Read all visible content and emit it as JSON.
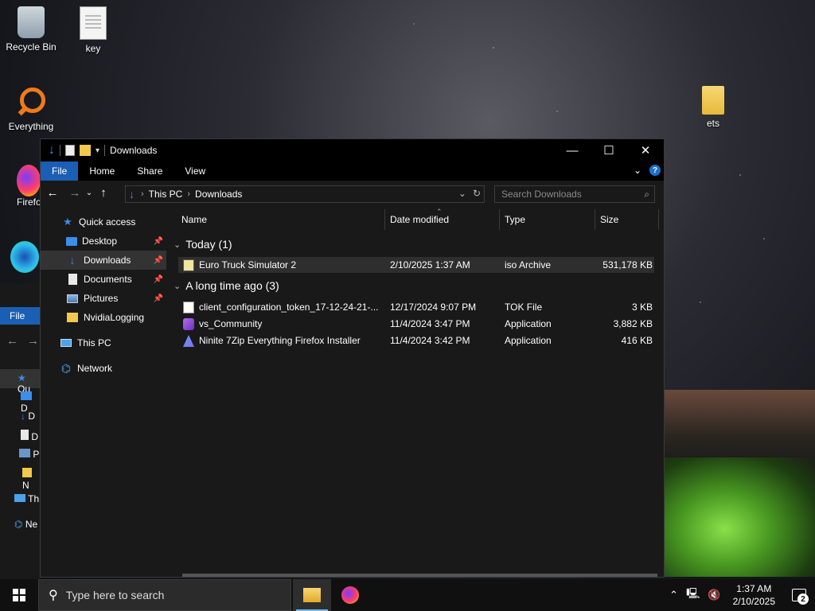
{
  "desktop": {
    "icons": [
      {
        "label": "Recycle Bin"
      },
      {
        "label": "key"
      },
      {
        "label": "Everything"
      },
      {
        "label": "Firefo"
      },
      {
        "label": "ets"
      }
    ]
  },
  "background_window": {
    "file_tab": "File",
    "nav_labels": [
      "Qu",
      "D",
      "D",
      "D",
      "P",
      "N",
      "Th",
      "Ne"
    ]
  },
  "window": {
    "title": "Downloads",
    "controls": {
      "minimize": "—",
      "maximize": "☐",
      "close": "✕"
    },
    "ribbon_tabs": [
      "File",
      "Home",
      "Share",
      "View"
    ],
    "address": {
      "crumbs": [
        "This PC",
        "Downloads"
      ]
    },
    "search": {
      "placeholder": "Search Downloads"
    },
    "nav_pane": [
      {
        "label": "Quick access",
        "icon": "star-icon"
      },
      {
        "label": "Desktop",
        "icon": "desktop-icon",
        "pinned": true
      },
      {
        "label": "Downloads",
        "icon": "download-icon",
        "pinned": true,
        "selected": true
      },
      {
        "label": "Documents",
        "icon": "document-icon",
        "pinned": true
      },
      {
        "label": "Pictures",
        "icon": "pictures-icon",
        "pinned": true
      },
      {
        "label": "NvidiaLogging",
        "icon": "folder-icon"
      },
      {
        "label": "This PC",
        "icon": "computer-icon"
      },
      {
        "label": "Network",
        "icon": "network-icon"
      }
    ],
    "columns": [
      "Name",
      "Date modified",
      "Type",
      "Size"
    ],
    "groups": [
      {
        "label": "Today (1)",
        "files": [
          {
            "name": "Euro Truck Simulator 2",
            "date": "2/10/2025 1:37 AM",
            "type": "iso Archive",
            "size": "531,178 KB",
            "icon": "iso-file-icon",
            "selected": true
          }
        ]
      },
      {
        "label": "A long time ago (3)",
        "files": [
          {
            "name": "client_configuration_token_17-12-24-21-...",
            "date": "12/17/2024 9:07 PM",
            "type": "TOK File",
            "size": "3 KB",
            "icon": "tok-file-icon"
          },
          {
            "name": "vs_Community",
            "date": "11/4/2024 3:47 PM",
            "type": "Application",
            "size": "3,882 KB",
            "icon": "visual-studio-icon"
          },
          {
            "name": "Ninite 7Zip Everything Firefox Installer",
            "date": "11/4/2024 3:42 PM",
            "type": "Application",
            "size": "416 KB",
            "icon": "ninite-icon"
          }
        ]
      }
    ]
  },
  "taskbar": {
    "search_placeholder": "Type here to search",
    "time": "1:37 AM",
    "date": "2/10/2025",
    "notification_count": "2"
  }
}
